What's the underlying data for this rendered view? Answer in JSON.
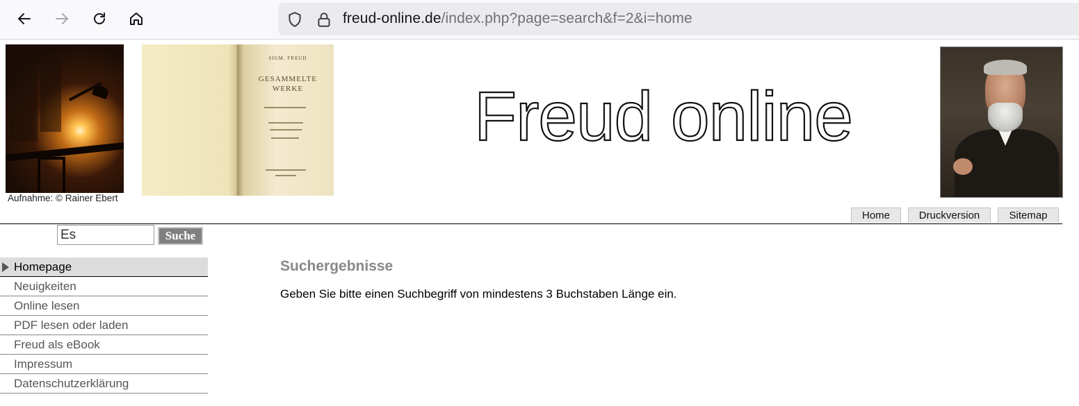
{
  "browser": {
    "url_domain": "freud-online.de",
    "url_path": "/index.php?page=search&f=2&i=home",
    "icons": [
      "back-arrow-icon",
      "forward-arrow-icon",
      "reload-icon",
      "home-icon",
      "shield-icon",
      "lock-icon"
    ]
  },
  "header": {
    "logo_text": "Freud online",
    "photo_caption": "Aufnahme: © Rainer Ebert",
    "book_text": {
      "author": "SIGM. FREUD",
      "title_line1": "GESAMMELTE",
      "title_line2": "WERKE"
    }
  },
  "topnav": {
    "home": "Home",
    "print": "Druckversion",
    "sitemap": "Sitemap"
  },
  "search": {
    "value": "Es",
    "button_label": "Suche"
  },
  "sidebar": {
    "items": [
      {
        "label": "Homepage",
        "active": true
      },
      {
        "label": "Neuigkeiten"
      },
      {
        "label": "Online lesen"
      },
      {
        "label": "PDF lesen oder laden"
      },
      {
        "label": "Freud als eBook"
      },
      {
        "label": "Impressum"
      },
      {
        "label": "Datenschutzerklärung"
      }
    ]
  },
  "main": {
    "title": "Suchergebnisse",
    "message": "Geben Sie bitte einen Suchbegriff von mindestens 3 Buchstaben Länge ein."
  },
  "colors": {
    "accent_gray": "#888888",
    "nav_button_bg": "#e7e7e7",
    "active_item_bg": "#dcdcdc",
    "search_button_bg": "#808080"
  }
}
